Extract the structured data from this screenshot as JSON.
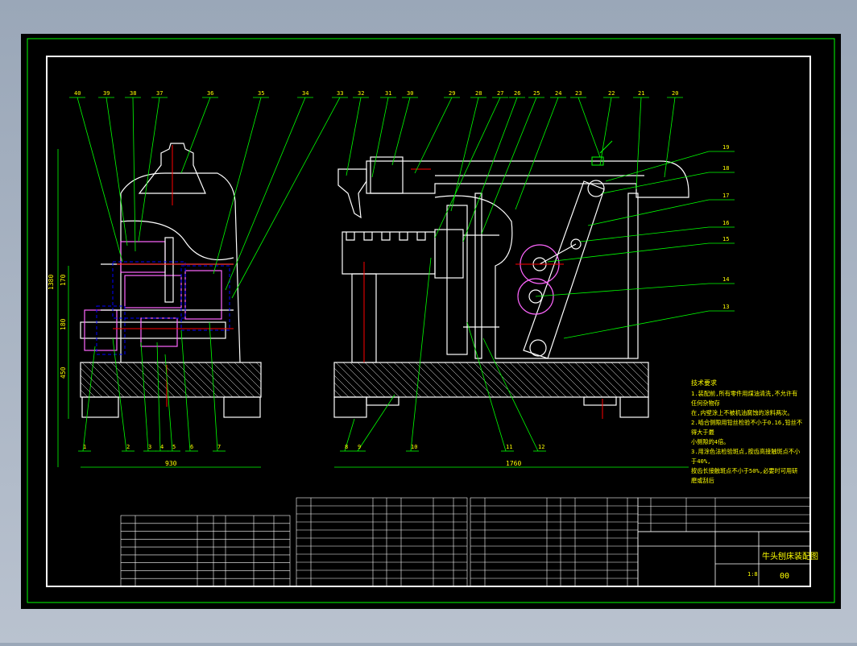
{
  "drawing": {
    "colors": {
      "background": "#000000",
      "border": "#00ff00",
      "line": "#ffffff",
      "center": "#ff0000",
      "hidden": "#0000ff",
      "leader": "#00ff00",
      "text": "#ffff00",
      "part": "#ff66ff"
    },
    "leaders_top": [
      "40",
      "39",
      "38",
      "37",
      "36",
      "35",
      "34",
      "33",
      "32",
      "31",
      "30",
      "29",
      "28",
      "27",
      "26",
      "25",
      "24",
      "23",
      "22",
      "21",
      "20"
    ],
    "leaders_bottom": [
      "1",
      "2",
      "3",
      "4",
      "5",
      "6",
      "7",
      "8",
      "9",
      "10",
      "11",
      "12"
    ],
    "leaders_right": [
      "19",
      "18",
      "17",
      "16",
      "15",
      "14",
      "13"
    ],
    "dimensions": {
      "left_total_height": "1380",
      "left_170": "170",
      "left_180": "180",
      "left_450": "450",
      "left_width": "930",
      "right_width": "1760"
    },
    "tech_req": {
      "title": "技术要求",
      "lines": [
        "1.装配前,所有零件用煤油清洗,不允许有",
        "任何杂物存",
        "在,内壁涂上不被机油腐蚀的涂料两次。",
        "2.啮合侧隙用铅丝检验不小于0.16,铅丝不",
        "得大于最",
        "小侧隙的4倍。",
        "3.用涂色法检验斑点,按齿高接触斑点不小",
        "于40%,",
        "按齿长接触斑点不小于50%,必要时可用研",
        "磨或刮后"
      ]
    },
    "title_block": {
      "name": "牛头刨床装配图",
      "drawing_no": "00",
      "scale": "1:8"
    }
  }
}
